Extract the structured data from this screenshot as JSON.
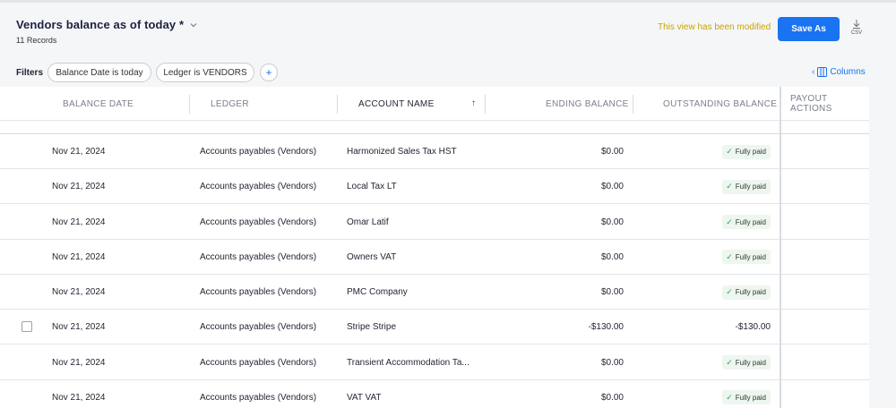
{
  "header": {
    "title": "Vendors balance as of today *",
    "records": "11 Records",
    "modified_notice": "This view has been modified",
    "save_as_label": "Save As",
    "csv_label": "CSV"
  },
  "filters": {
    "label": "Filters",
    "chips": [
      "Balance Date is today",
      "Ledger is VENDORS"
    ],
    "add_label": "+",
    "columns_label": "Columns"
  },
  "table": {
    "columns": {
      "balance_date": "BALANCE DATE",
      "ledger": "LEDGER",
      "account_name": "ACCOUNT NAME",
      "sort_indicator": "↑",
      "ending_balance": "ENDING BALANCE",
      "outstanding_balance": "OUTSTANDING BALANCE",
      "payout_actions": "PAYOUT ACTIONS"
    },
    "rows": [
      {
        "date": "Nov 21, 2024",
        "ledger": "Accounts payables (Vendors)",
        "account": "Harmonized Sales Tax HST",
        "ending": "$0.00",
        "outstanding": "Fully paid",
        "paid": true
      },
      {
        "date": "Nov 21, 2024",
        "ledger": "Accounts payables (Vendors)",
        "account": "Local Tax LT",
        "ending": "$0.00",
        "outstanding": "Fully paid",
        "paid": true
      },
      {
        "date": "Nov 21, 2024",
        "ledger": "Accounts payables (Vendors)",
        "account": "Omar Latif",
        "ending": "$0.00",
        "outstanding": "Fully paid",
        "paid": true
      },
      {
        "date": "Nov 21, 2024",
        "ledger": "Accounts payables (Vendors)",
        "account": "Owners VAT",
        "ending": "$0.00",
        "outstanding": "Fully paid",
        "paid": true
      },
      {
        "date": "Nov 21, 2024",
        "ledger": "Accounts payables (Vendors)",
        "account": "PMC Company",
        "ending": "$0.00",
        "outstanding": "Fully paid",
        "paid": true
      },
      {
        "date": "Nov 21, 2024",
        "ledger": "Accounts payables (Vendors)",
        "account": "Stripe Stripe",
        "ending": "-$130.00",
        "outstanding": "-$130.00",
        "paid": false
      },
      {
        "date": "Nov 21, 2024",
        "ledger": "Accounts payables (Vendors)",
        "account": "Transient Accommodation Ta...",
        "ending": "$0.00",
        "outstanding": "Fully paid",
        "paid": true
      },
      {
        "date": "Nov 21, 2024",
        "ledger": "Accounts payables (Vendors)",
        "account": "VAT VAT",
        "ending": "$0.00",
        "outstanding": "Fully paid",
        "paid": true
      }
    ]
  },
  "colors": {
    "accent": "#1a73f0",
    "modified": "#c9a400",
    "paid_check": "#2e9e5b",
    "paid_bg": "#eef6f0"
  },
  "icons": {
    "title_dropdown": "chevron-down-icon",
    "csv": "download-icon",
    "columns": "columns-icon",
    "paid": "check-icon",
    "sort": "arrow-up-icon"
  }
}
